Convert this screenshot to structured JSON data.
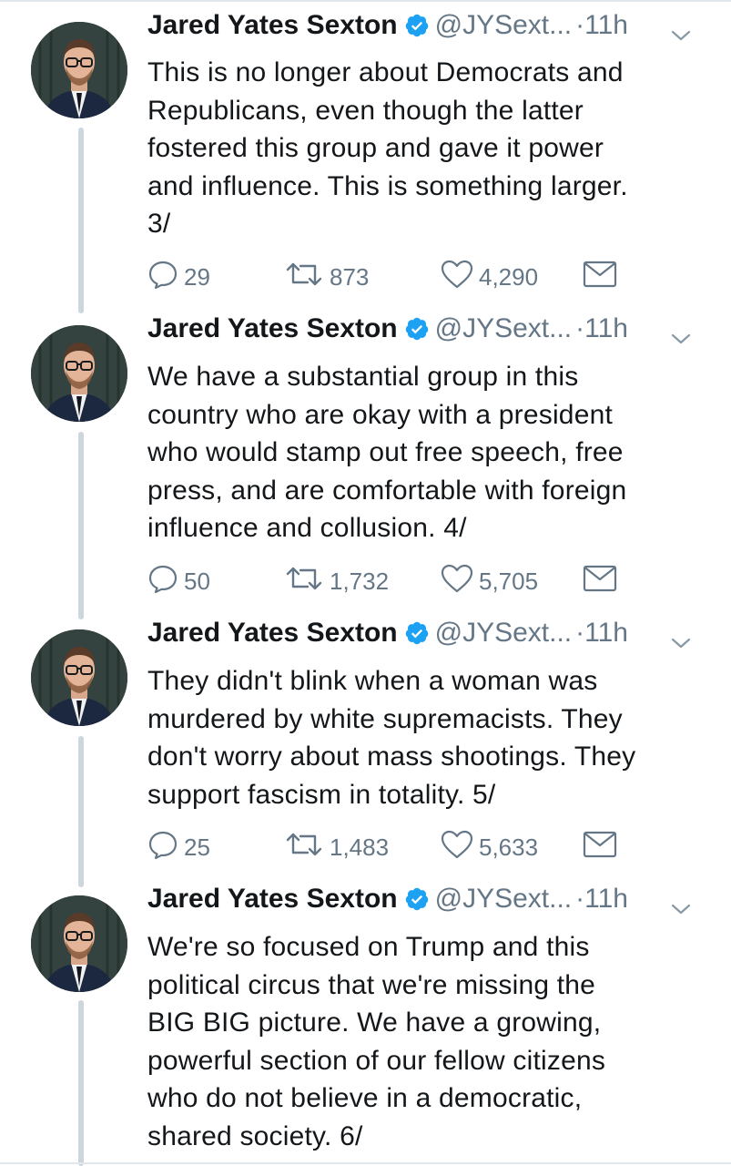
{
  "tweets": [
    {
      "name": "Jared Yates Sexton",
      "handle": "@JYSext...",
      "dot": "·",
      "time": "11h",
      "lines": [
        "This is no longer about Democrats and",
        "Republicans, even though the latter",
        "fostered this group and gave it power",
        "and influence. This is something larger.",
        "3/"
      ],
      "replies": "29",
      "retweets": "873",
      "likes": "4,290"
    },
    {
      "name": "Jared Yates Sexton",
      "handle": "@JYSext...",
      "dot": "·",
      "time": "11h",
      "lines": [
        "We have a substantial group in this",
        "country who are okay with a president",
        "who would stamp out free speech, free",
        "press, and are comfortable with foreign",
        "influence and collusion. 4/"
      ],
      "replies": "50",
      "retweets": "1,732",
      "likes": "5,705"
    },
    {
      "name": "Jared Yates Sexton",
      "handle": "@JYSext...",
      "dot": "·",
      "time": "11h",
      "lines": [
        "They didn't blink when a woman was",
        "murdered by white supremacists. They",
        "don't worry about mass shootings. They",
        "support fascism in totality. 5/"
      ],
      "replies": "25",
      "retweets": "1,483",
      "likes": "5,633"
    },
    {
      "name": "Jared Yates Sexton",
      "handle": "@JYSext...",
      "dot": "·",
      "time": "11h",
      "lines": [
        "We're so focused on Trump and this",
        "political circus that we're missing the",
        "BIG BIG picture. We have a growing,",
        "powerful section of our fellow citizens",
        "who do not believe in a democratic,",
        "shared society. 6/"
      ]
    }
  ],
  "colors": {
    "verified": "#1da1f2",
    "muted": "#657786",
    "thread": "#ccd6dd",
    "text": "#14171a"
  },
  "icons": {
    "reply": "reply-icon",
    "retweet": "retweet-icon",
    "like": "heart-icon",
    "dm": "mail-icon",
    "verified": "verified-badge-icon",
    "more": "chevron-down-icon"
  }
}
